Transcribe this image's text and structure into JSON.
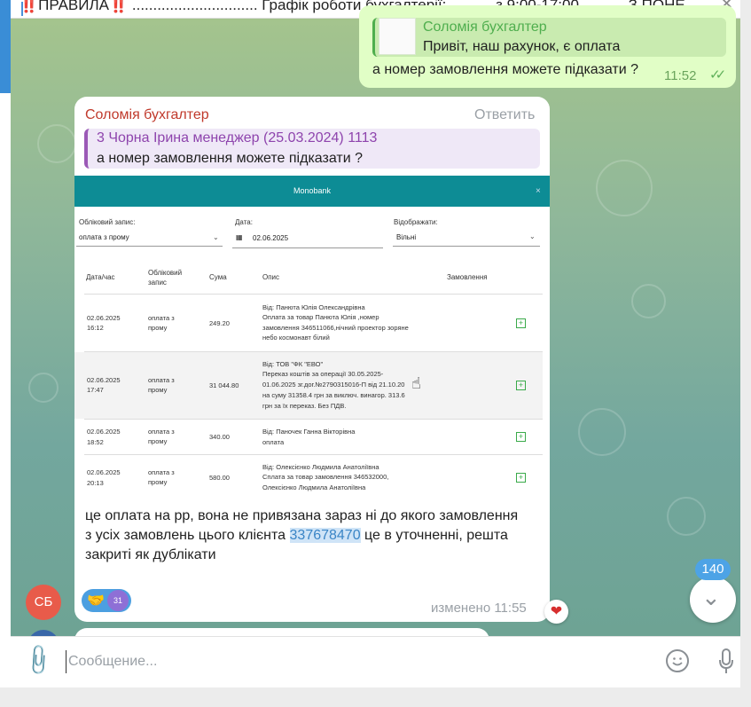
{
  "pinned": {
    "text": "‼️ПРАВИЛА‼️ .............................. Графік роботи бухгалтерії: ———з 9:00-17:00——— З ПОНЕ..."
  },
  "outgoing": {
    "reply_name": "Соломія бухгалтер",
    "reply_text": "Привіт, наш рахунок, є оплата",
    "text": "а номер замовлення можете підказати ?",
    "time": "11:52",
    "ticks": "✓✓"
  },
  "incoming": {
    "sender": "Соломія бухгалтер",
    "reply_action": "Ответить",
    "quote_name": "3 Чорна Ірина менеджер (25.03.2024) 1113",
    "quote_text": "а номер замовлення можете підказати ?",
    "text_part1": "це оплата на рр, вона не привязана зараз ні до якого замовлення",
    "text_part2": "з усіх замовлень цього клієнта ",
    "text_link": "337678470",
    "text_part3": " це в уточненні, решта закриті як дублікати",
    "edited": "изменено 11:55",
    "reaction_emoji": "🤝",
    "reaction_count": "31",
    "heart": "❤"
  },
  "monobank": {
    "title": "Monobank",
    "close": "×",
    "filters": {
      "account_label": "Обліковий запис:",
      "account_value": "оплата з прому",
      "date_label": "Дата:",
      "date_value": "02.06.2025",
      "display_label": "Відображати:",
      "display_value": "Вільні"
    },
    "headers": [
      "Дата/час",
      "Обліковий запис",
      "Сума",
      "Опис",
      "Замовлення"
    ],
    "rows": [
      {
        "date": "02.06.2025",
        "time": "16:12",
        "account": "оплата з прому",
        "amount": "249.20",
        "desc": [
          "Від: Панюта Юлія Олександрівна",
          "Оплата за товар Панюта Юлія ,номер",
          "замовлення 346511066,нічний проектор зоряне",
          "небо космонавт білий"
        ],
        "action": "+"
      },
      {
        "date": "02.06.2025",
        "time": "17:47",
        "account": "оплата з прому",
        "amount": "31 044.80",
        "desc": [
          "Від: ТОВ \"ФК \"ЕВО\"",
          "Переказ коштів за операції 30.05.2025-",
          "01.06.2025 зг.дог.№2790315016-П від 21.10.20",
          "на суму 31358.4 грн за виключ. винагор. 313.6",
          "грн за їх переказ. Без ПДВ."
        ],
        "action": "+"
      },
      {
        "date": "02.06.2025",
        "time": "18:52",
        "account": "оплата з прому",
        "amount": "340.00",
        "desc": [
          "Від: Паночек Ганна Вікторівна",
          "оплата"
        ],
        "action": "+"
      },
      {
        "date": "02.06.2025",
        "time": "20:13",
        "account": "оплата з прому",
        "amount": "580.00",
        "desc": [
          "Від: Олексієнко Людмила Анатоліївна",
          "Сплата за товар замовлення 346532000,",
          "Олексієнко Людмила Анатоліївна"
        ],
        "action": "+"
      }
    ]
  },
  "avatar_initials": "СБ",
  "unread_count": "140",
  "composer": {
    "placeholder": "Сообщение..."
  },
  "icons": {
    "attach": "paperclip-icon",
    "emoji": "smile-icon",
    "mic": "microphone-icon",
    "scroll": "chevron-down-icon"
  }
}
